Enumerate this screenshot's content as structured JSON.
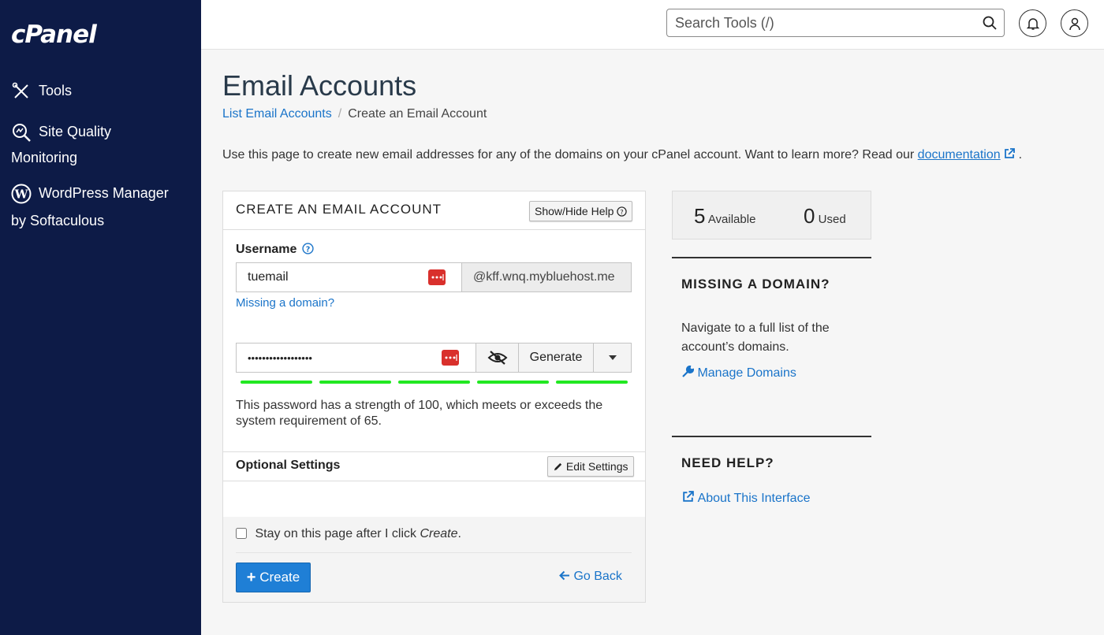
{
  "sidebar": {
    "logo": "cPanel",
    "items": [
      {
        "label": "Tools"
      },
      {
        "label_line1": "Site Quality",
        "label_line2": "Monitoring"
      },
      {
        "label_line1": "WordPress Manager",
        "label_line2": "by Softaculous"
      }
    ]
  },
  "header": {
    "search_placeholder": "Search Tools (/)"
  },
  "page": {
    "title": "Email Accounts",
    "breadcrumb_link": "List Email Accounts",
    "breadcrumb_sep": "/",
    "breadcrumb_current": "Create an Email Account",
    "intro_text": "Use this page to create new email addresses for any of the domains on your cPanel account. Want to learn more? Read our ",
    "intro_link": "documentation",
    "intro_end": "."
  },
  "form": {
    "title": "CREATE AN EMAIL ACCOUNT",
    "help_button": "Show/Hide Help",
    "username_label": "Username",
    "username_value": "tuemail",
    "domain_suffix": "@kff.wnq.mybluehost.me",
    "missing_domain_link": "Missing a domain?",
    "password_value": "••••••••••••••••••",
    "generate_button": "Generate",
    "password_strength": 100,
    "strength_message": "This password has a strength of 100, which meets or exceeds the system requirement of 65.",
    "optional_title": "Optional Settings",
    "edit_settings_button": "Edit Settings",
    "stay_label_pre": "Stay on this page after I click ",
    "stay_label_em": "Create",
    "stay_label_post": ".",
    "create_button": "Create",
    "go_back_link": "Go Back"
  },
  "stats": {
    "available_count": "5",
    "available_label": "Available",
    "used_count": "0",
    "used_label": "Used"
  },
  "right": {
    "missing_title": "MISSING A DOMAIN?",
    "missing_text": "Navigate to a full list of the account’s domains.",
    "manage_link": "Manage Domains",
    "help_title": "NEED HELP?",
    "about_link": "About This Interface"
  },
  "colors": {
    "sidebar_bg": "#0d1b47",
    "link": "#1a74c9",
    "primary": "#1f7fd6",
    "strength": "#22e822",
    "password_manager": "#d9302c"
  }
}
